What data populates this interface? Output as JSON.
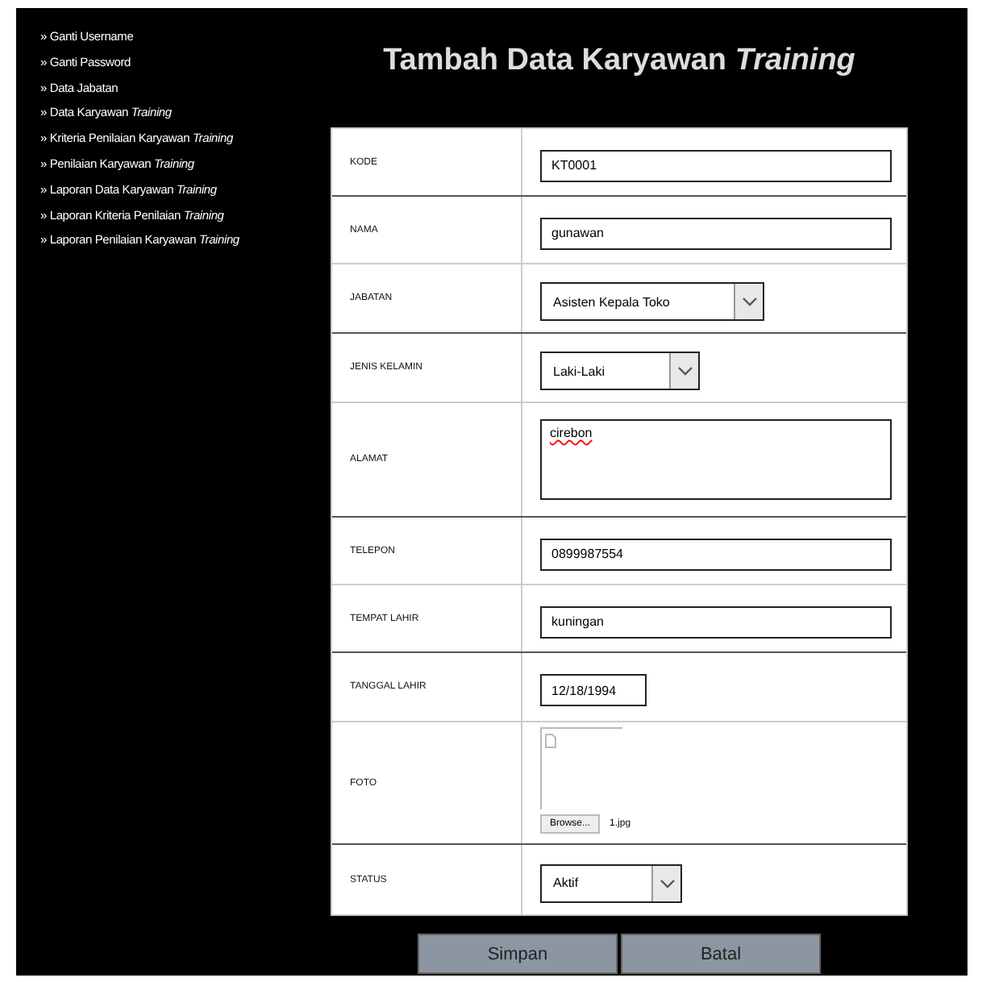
{
  "sidebar": {
    "items": [
      "» Ganti Username",
      "» Ganti Password",
      "» Data Jabatan",
      "» Data Karyawan *Training*",
      "» Kriteria Penilaian Karyawan *Training*",
      "» Penilaian Karyawan *Training*",
      "» Laporan Data Karyawan *Training*",
      "» Laporan Kriteria Penilaian *Training*",
      "» Laporan Penilaian Karyawan *Training*"
    ]
  },
  "title": "Tambah Data Karyawan *Training*",
  "form": {
    "rows": [
      {
        "label": "KODE",
        "kind": "text",
        "value": "KT0001"
      },
      {
        "label": "NAMA",
        "kind": "text",
        "value": "gunawan"
      },
      {
        "label": "JABATAN",
        "kind": "select",
        "value": "Asisten Kepala Toko"
      },
      {
        "label": "JENIS KELAMIN",
        "kind": "select",
        "value": "Laki-Laki"
      },
      {
        "label": "ALAMAT",
        "kind": "textarea",
        "value": "cirebon"
      },
      {
        "label": "TELEPON",
        "kind": "text",
        "value": "0899987554"
      },
      {
        "label": "TEMPAT LAHIR",
        "kind": "text",
        "value": "kuningan"
      },
      {
        "label": "TANGGAL LAHIR",
        "kind": "date",
        "value": "12/18/1994"
      },
      {
        "label": "FOTO",
        "kind": "file",
        "button": "Browse...",
        "value": "1.jpg"
      },
      {
        "label": "STATUS",
        "kind": "select",
        "value": "Aktif"
      }
    ]
  },
  "buttons": [
    "Simpan",
    "Batal"
  ]
}
